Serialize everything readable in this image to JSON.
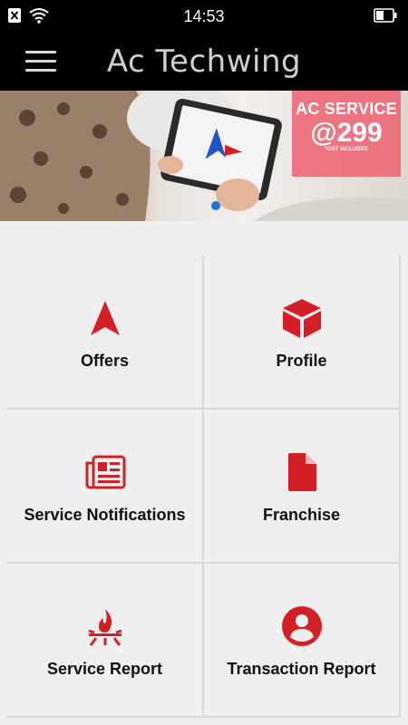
{
  "status": {
    "time": "14:53",
    "icons": [
      "notification-x-icon",
      "wifi-icon",
      "battery-icon"
    ]
  },
  "app_bar": {
    "title": "Ac Techwing",
    "menu_icon": "hamburger-menu-icon"
  },
  "banner": {
    "promo_title": "AC SERVICE",
    "promo_price": "@299",
    "promo_note": "*GST INCLUDED"
  },
  "tiles": [
    {
      "label": "Offers",
      "icon": "navigation-arrow-icon"
    },
    {
      "label": "Profile",
      "icon": "cube-icon"
    },
    {
      "label": "Service Notifications",
      "icon": "newspaper-icon"
    },
    {
      "label": "Franchise",
      "icon": "document-icon"
    },
    {
      "label": "Service Report",
      "icon": "fire-icon"
    },
    {
      "label": "Transaction Report",
      "icon": "account-circle-icon"
    }
  ],
  "colors": {
    "accent": "#d32027",
    "bar": "#000000",
    "background": "#efefef",
    "promo": "#ec6270",
    "indicator": "#1e73d8"
  }
}
